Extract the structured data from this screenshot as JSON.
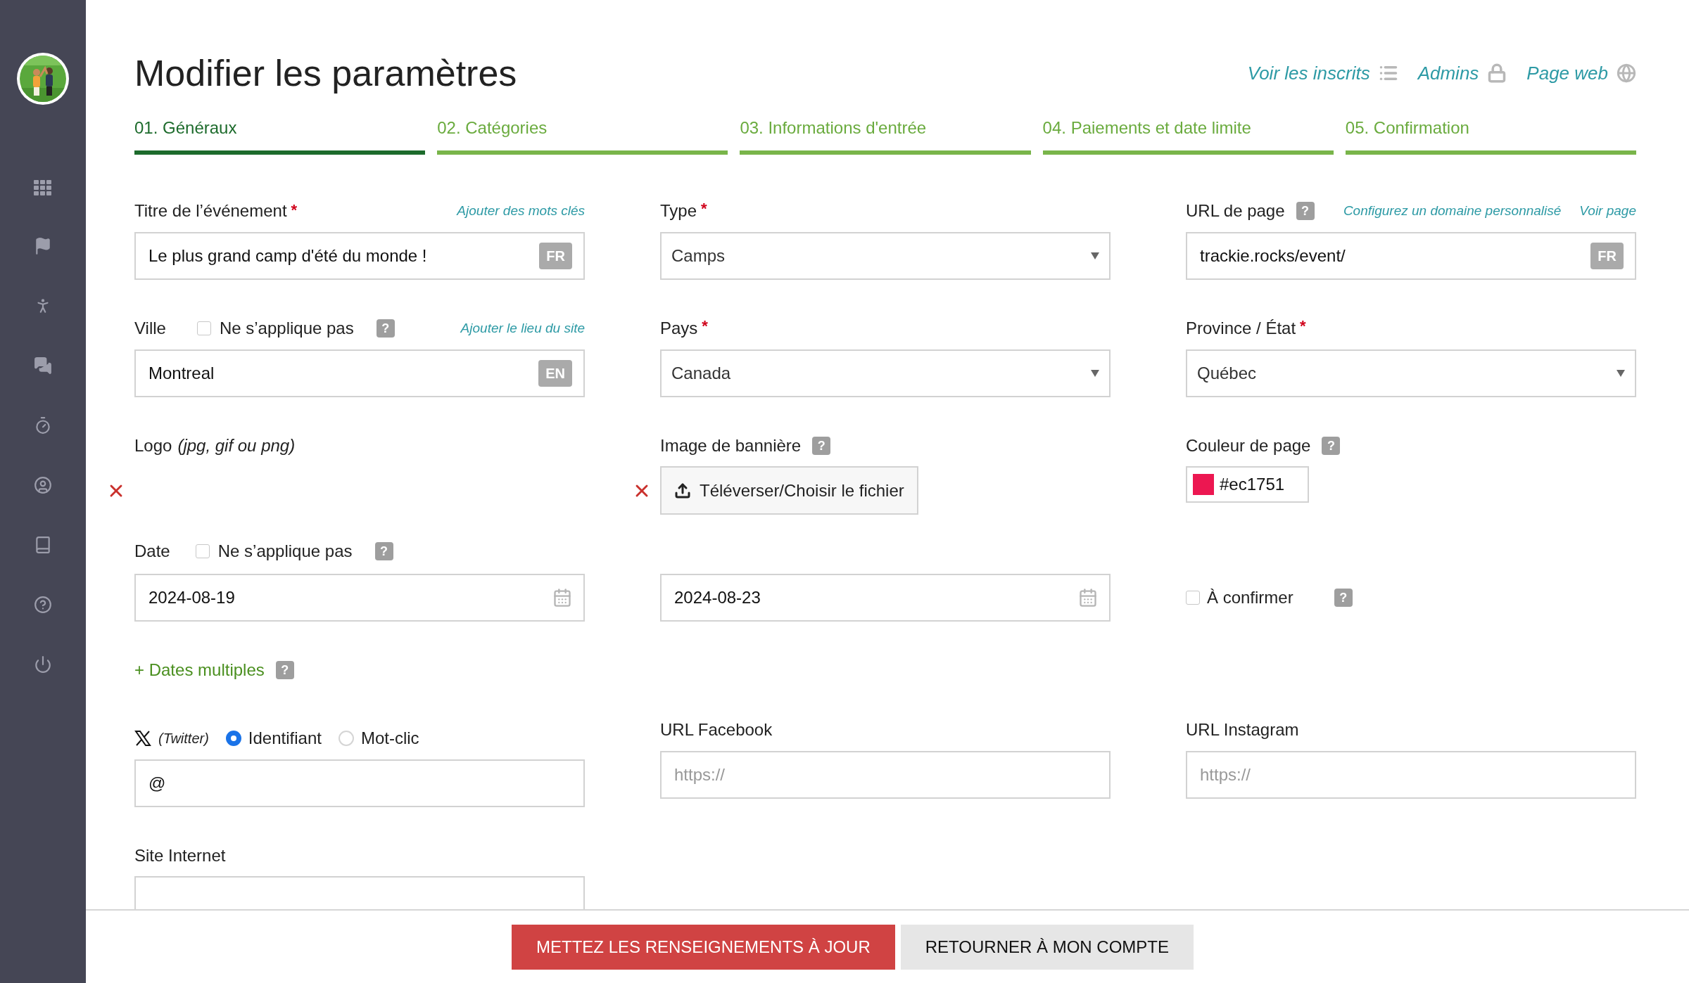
{
  "header": {
    "title": "Modifier les paramètres",
    "links": [
      {
        "label": "Voir les inscrits",
        "kind": "list"
      },
      {
        "label": "Admins",
        "kind": "lock"
      },
      {
        "label": "Page web",
        "kind": "globe"
      }
    ]
  },
  "tabs": [
    {
      "label": "01. Généraux",
      "selected": true
    },
    {
      "label": "02. Catégories",
      "selected": false
    },
    {
      "label": "03. Informations d'entrée",
      "selected": false
    },
    {
      "label": "04. Paiements et date limite",
      "selected": false
    },
    {
      "label": "05. Confirmation",
      "selected": false
    }
  ],
  "event_title": {
    "label": "Titre de l’événement",
    "required_mark": "*",
    "link": "Ajouter des mots clés",
    "value": "Le plus grand camp d'été du monde !",
    "lang": "FR"
  },
  "type": {
    "label": "Type",
    "required_mark": "*",
    "value": "Camps"
  },
  "page_url": {
    "label": "URL de page",
    "help": "?",
    "links": [
      "Configurez un domaine personnalisé",
      "Voir page"
    ],
    "value": "trackie.rocks/event/",
    "lang": "FR"
  },
  "city": {
    "label": "Ville",
    "not_applicable": {
      "label": "Ne s’applique pas",
      "checked": false
    },
    "help": "?",
    "link": "Ajouter le lieu du site",
    "value": "Montreal",
    "lang": "EN"
  },
  "country": {
    "label": "Pays",
    "required_mark": "*",
    "value": "Canada"
  },
  "province": {
    "label": "Province / État",
    "required_mark": "*",
    "value": "Québec"
  },
  "logo": {
    "label": "Logo",
    "hint": "(jpg, gif ou png)"
  },
  "banner": {
    "label": "Image de bannière",
    "help": "?",
    "button": "Téléverser/Choisir le fichier"
  },
  "page_color": {
    "label": "Couleur de page",
    "help": "?",
    "value": "#ec1751",
    "color": "#ec1751"
  },
  "date": {
    "label": "Date",
    "not_applicable": {
      "label": "Ne s’applique pas",
      "checked": false
    },
    "help": "?",
    "start": "2024-08-19",
    "end": "2024-08-23"
  },
  "to_confirm": {
    "label": "À confirmer",
    "checked": false,
    "help": "?"
  },
  "multiple_dates": {
    "label": "+ Dates multiples",
    "help": "?"
  },
  "twitter": {
    "label": "(Twitter)",
    "options": [
      {
        "label": "Identifiant",
        "selected": true
      },
      {
        "label": "Mot-clic",
        "selected": false
      }
    ],
    "value": "@"
  },
  "facebook": {
    "label": "URL Facebook",
    "placeholder": "https://"
  },
  "instagram": {
    "label": "URL Instagram",
    "placeholder": "https://"
  },
  "website": {
    "label": "Site Internet"
  },
  "footer": {
    "buttons": [
      {
        "label": "METTEZ LES RENSEIGNEMENTS À JOUR",
        "kind": "primary"
      },
      {
        "label": "RETOURNER À MON COMPTE",
        "kind": "secondary"
      }
    ]
  }
}
